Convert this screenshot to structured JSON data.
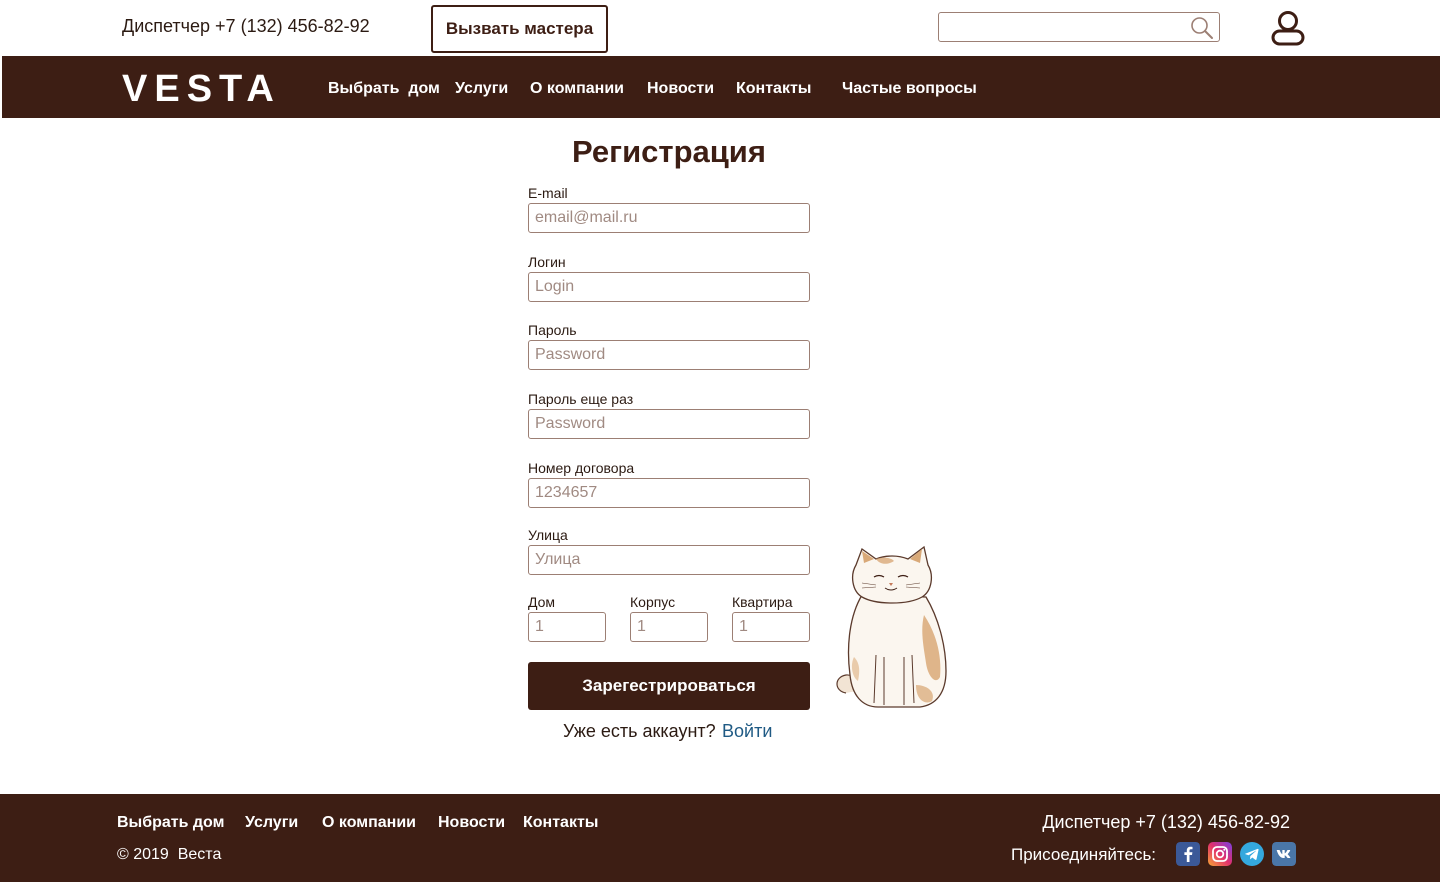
{
  "header": {
    "dispatcher": "Диспетчер +7 (132) 456-82-92",
    "call_master": "Вызвать мастера",
    "search_value": ""
  },
  "nav": {
    "logo": "VESTA",
    "items": [
      "Выбрать  дом",
      "Услуги",
      "О компании",
      "Новости",
      "Контакты",
      "Частые вопросы"
    ]
  },
  "form": {
    "title": "Регистрация",
    "fields": [
      {
        "label": "E-mail",
        "placeholder": "email@mail.ru"
      },
      {
        "label": "Логин",
        "placeholder": "Login"
      },
      {
        "label": "Пароль",
        "placeholder": "Password"
      },
      {
        "label": "Пароль еще раз",
        "placeholder": "Password"
      },
      {
        "label": "Номер договора",
        "placeholder": "1234657"
      },
      {
        "label": "Улица",
        "placeholder": "Улица"
      }
    ],
    "address": [
      {
        "label": "Дом",
        "placeholder": "1"
      },
      {
        "label": "Корпус",
        "placeholder": "1"
      },
      {
        "label": "Квартира",
        "placeholder": "1"
      }
    ],
    "submit": "Зарегестрироваться",
    "already_text": "Уже есть аккаунт?",
    "login_link": "Войти"
  },
  "footer": {
    "links": [
      "Выбрать дом",
      "Услуги",
      "О компании",
      "Новости",
      "Контакты"
    ],
    "copyright": "© 2019  Веста",
    "dispatcher": "Диспетчер +7 (132) 456-82-92",
    "join": "Присоединяйтесь:",
    "social": [
      "facebook-icon",
      "instagram-icon",
      "telegram-icon",
      "vk-icon"
    ]
  },
  "colors": {
    "brand": "#3d1e14",
    "link": "#1f5a84",
    "input_border": "#9c7f74"
  }
}
